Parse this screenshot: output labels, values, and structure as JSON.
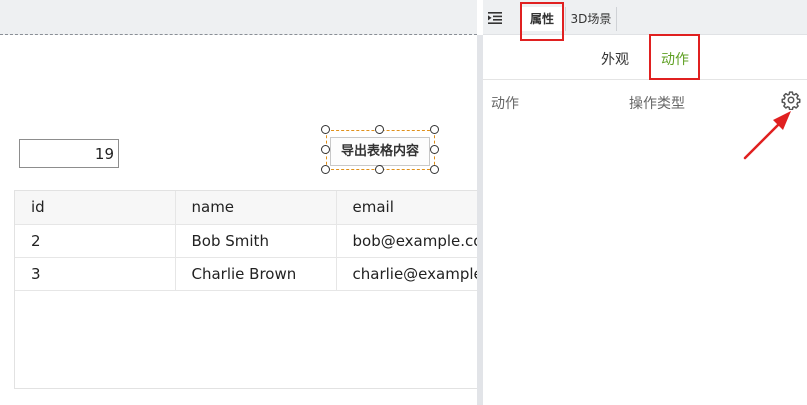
{
  "canvas": {
    "number_input": "19",
    "export_button": "导出表格内容",
    "table": {
      "columns": [
        "id",
        "name",
        "email"
      ],
      "rows": [
        [
          "2",
          "Bob Smith",
          "bob@example.com"
        ],
        [
          "3",
          "Charlie Brown",
          "charlie@example.com"
        ]
      ]
    }
  },
  "panel": {
    "collapse_icon": "collapse-panel-icon",
    "tabs": [
      "属性",
      "3D场景"
    ],
    "active_tab": "属性",
    "subtabs": [
      "外观",
      "动作"
    ],
    "active_subtab": "动作",
    "columns": [
      "动作",
      "操作类型"
    ],
    "settings_icon": "gear-icon"
  },
  "colors": {
    "accent_green": "#5fa024",
    "highlight_red": "#e02020",
    "selection_orange": "#e0901a"
  }
}
